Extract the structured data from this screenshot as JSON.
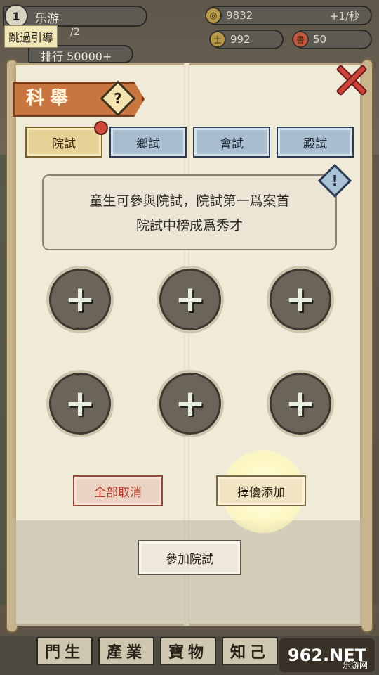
{
  "player": {
    "level": "1",
    "name": "乐游",
    "skip_guide": "跳過引導",
    "progress": "/2",
    "rank": "排行 50000+"
  },
  "resources": {
    "coins": {
      "icon": "coin-icon",
      "value": "9832",
      "rate": "+1/秒"
    },
    "resource_b": {
      "icon": "scholar-icon",
      "value": "992"
    },
    "resource_c": {
      "icon": "book-icon",
      "value": "50"
    }
  },
  "panel": {
    "title": "科舉",
    "help_symbol": "?",
    "warn_symbol": "!",
    "tabs": [
      {
        "label": "院試",
        "active": true,
        "has_badge": true
      },
      {
        "label": "鄉試",
        "active": false
      },
      {
        "label": "會試",
        "active": false
      },
      {
        "label": "殿試",
        "active": false
      }
    ],
    "description_lines": [
      "童生可參與院試，院試第一爲案首",
      "院試中榜成爲秀才"
    ],
    "slots": [
      "+",
      "+",
      "+",
      "+",
      "+",
      "+"
    ],
    "buttons": {
      "cancel_all": "全部取消",
      "auto_add": "擇優添加",
      "join_exam": "參加院試"
    }
  },
  "bottom_nav": [
    "門生",
    "產業",
    "寶物",
    "知己"
  ],
  "watermark": {
    "text": "962.NET",
    "sub": "乐游网"
  },
  "colors": {
    "accent_red": "#d14a3c",
    "tab_blue": "#a9bfd0",
    "tab_active": "#e6d197",
    "parchment": "#f0ead8"
  }
}
